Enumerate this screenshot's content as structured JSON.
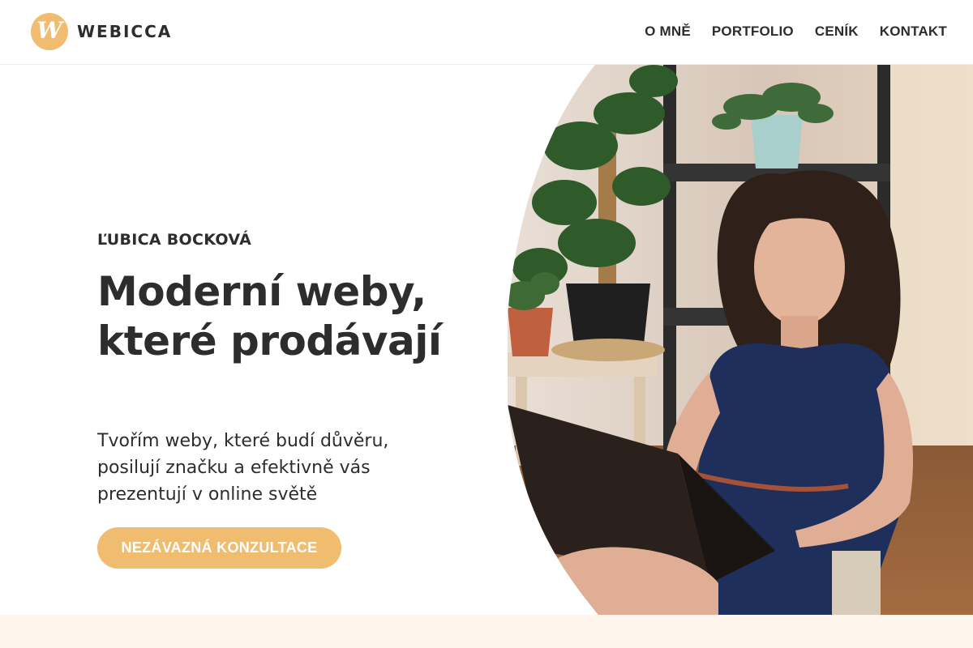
{
  "header": {
    "logo_letter": "W",
    "logo_text": "WEBICCA",
    "nav": [
      {
        "label": "O MNĚ"
      },
      {
        "label": "PORTFOLIO"
      },
      {
        "label": "CENÍK"
      },
      {
        "label": "KONTAKT"
      }
    ]
  },
  "hero": {
    "eyebrow": "ĽUBICA BOCKOVÁ",
    "headline": "Moderní weby, které prodávají",
    "subtext": "Tvořím weby, které budí důvěru, posilují značku a efektivně vás prezentují v online světě",
    "cta_label": "NEZÁVAZNÁ KONZULTACE"
  },
  "colors": {
    "accent": "#f0bc70",
    "text": "#2d2d2d",
    "band": "#fdf5ec"
  }
}
